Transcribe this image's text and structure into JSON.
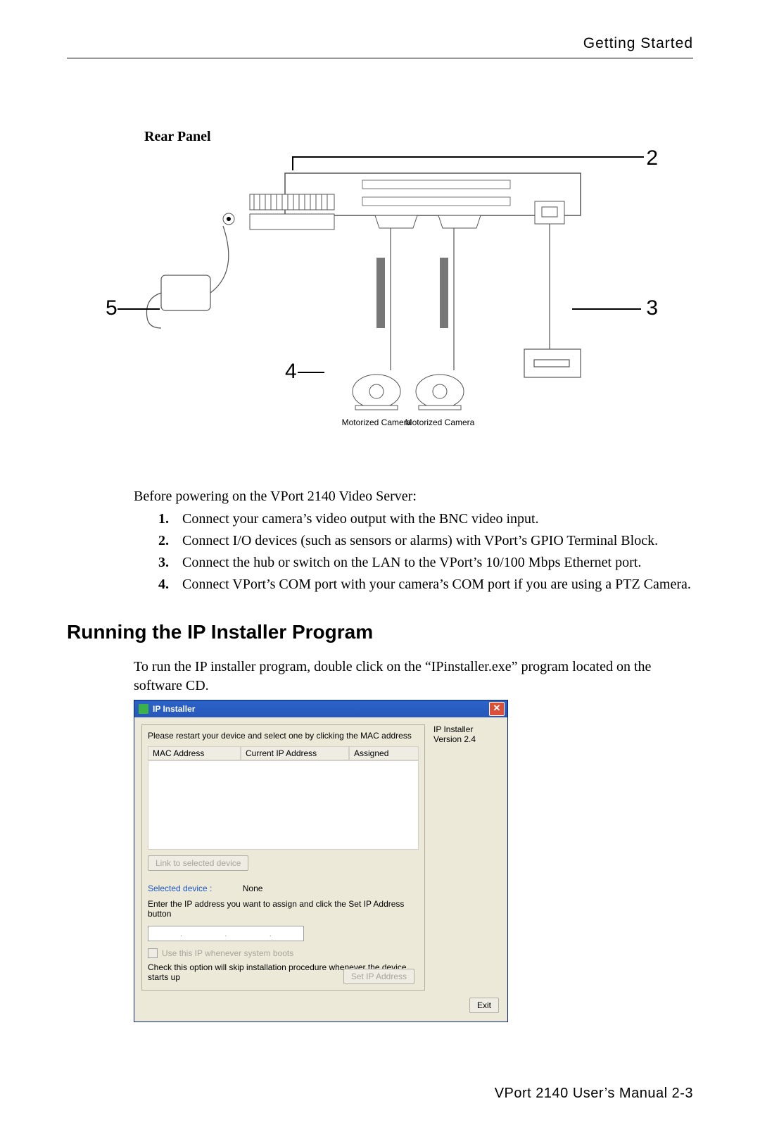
{
  "header": {
    "title": "Getting Started"
  },
  "rear_panel": {
    "heading": "Rear Panel",
    "callouts": {
      "n2": "2",
      "n3": "3",
      "n4": "4",
      "n5": "5"
    },
    "caption_left": "Motorized Camera",
    "caption_right": "Motorized Camera"
  },
  "preamble": "Before powering on the VPort 2140 Video Server:",
  "steps": [
    {
      "num": "1.",
      "text": "Connect your camera’s video output with the BNC video input."
    },
    {
      "num": "2.",
      "text": "Connect I/O devices (such as sensors or alarms) with VPort’s GPIO Terminal Block."
    },
    {
      "num": "3.",
      "text": "Connect the hub or switch on the LAN to the VPort’s 10/100 Mbps Ethernet port."
    },
    {
      "num": "4.",
      "text": "Connect VPort’s COM port with your camera’s COM port if you are using a PTZ Camera."
    }
  ],
  "section": {
    "title": "Running the IP Installer Program",
    "intro": "To run the IP installer program, double click on the “IPinstaller.exe” program located on the software CD."
  },
  "ipwin": {
    "title": "IP Installer",
    "app_name": "IP Installer",
    "version": "Version 2.4",
    "instruction": "Please restart your device and select one by clicking the MAC address",
    "cols": {
      "mac": "MAC Address",
      "ip": "Current IP Address",
      "assigned": "Assigned"
    },
    "link_btn": "Link to selected device",
    "selected_label": "Selected device :",
    "selected_value": "None",
    "enter_ip": "Enter the IP address you want to assign and click the Set IP Address button",
    "octet_sep": ".",
    "chk": "Use this IP whenever system boots",
    "note": "Check this option will skip installation procedure whenever the device starts up",
    "set_btn": "Set IP Address",
    "exit_btn": "Exit"
  },
  "footer": {
    "text": "VPort 2140 User’s Manual   2-3"
  }
}
